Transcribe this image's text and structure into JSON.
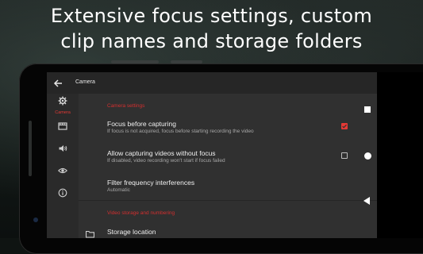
{
  "headline": {
    "line1": "Extensive focus settings, custom",
    "line2": "clip names and storage folders"
  },
  "appbar": {
    "title": "Camera"
  },
  "rail": {
    "items": [
      {
        "icon": "gear-icon",
        "label": "Camera",
        "active": true
      },
      {
        "icon": "film-icon",
        "label": "",
        "active": false
      },
      {
        "icon": "speaker-icon",
        "label": "",
        "active": false
      },
      {
        "icon": "eye-icon",
        "label": "",
        "active": false
      },
      {
        "icon": "info-icon",
        "label": "",
        "active": false
      }
    ]
  },
  "settings": {
    "camera_section": "Camera settings",
    "focus_before": {
      "title": "Focus before capturing",
      "subtitle": "If focus is not acquired, focus before starting recording the video",
      "checked": true
    },
    "allow_without_focus": {
      "title": "Allow capturing videos without focus",
      "subtitle": "If disabled, video recording won't start if focus failed",
      "checked": false
    },
    "filter_frequency": {
      "title": "Filter frequency interferences",
      "subtitle": "Automatic"
    },
    "storage_section": "Video storage and numbering",
    "storage_location": {
      "title": "Storage location",
      "icon": "folder-icon"
    }
  },
  "navigation": {
    "items": [
      "recents-square-icon",
      "home-circle-icon",
      "back-triangle-icon"
    ]
  },
  "colors": {
    "accent": "#e53935",
    "screen_bg": "#303030",
    "appbar_bg": "#262626"
  }
}
